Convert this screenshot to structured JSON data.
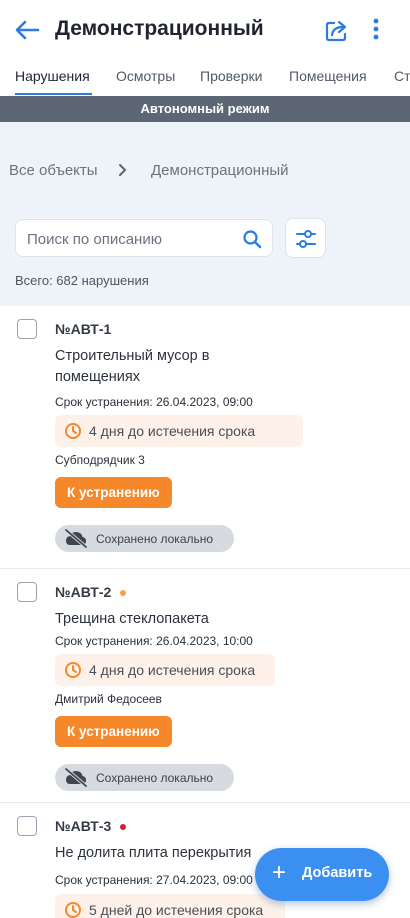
{
  "header": {
    "title": "Демонстрационный",
    "back_icon": "arrow-left-icon",
    "share_icon": "share-icon",
    "more_icon": "more-vertical-icon"
  },
  "tabs": [
    {
      "label": "Нарушения",
      "active": true
    },
    {
      "label": "Осмотры",
      "active": false
    },
    {
      "label": "Проверки",
      "active": false
    },
    {
      "label": "Помещения",
      "active": false
    },
    {
      "label": "Ст",
      "active": false
    }
  ],
  "offline_banner": "Автономный режим",
  "breadcrumb": {
    "items": [
      "Все объекты",
      "Демонстрационный"
    ]
  },
  "search": {
    "placeholder": "Поиск по описанию",
    "value": ""
  },
  "total_label": "Всего: 682 нарушения",
  "violations": [
    {
      "id": "№АВТ-1",
      "dot_color": "",
      "description": "Строительный мусор в помещениях",
      "deadline": "Срок устранения: 26.04.2023, 09:00",
      "time_left": "4 дня до истечения срока",
      "assignee": "Субподрядчик 3",
      "status": "К устранению",
      "sync": "Сохранено локально"
    },
    {
      "id": "№АВТ-2",
      "dot_color": "#f5a14a",
      "description": "Трещина стеклопакета",
      "deadline": "Срок устранения: 26.04.2023, 10:00",
      "time_left": "4 дня до истечения срока",
      "assignee": "Дмитрий Федосеев",
      "status": "К устранению",
      "sync": "Сохранено локально"
    },
    {
      "id": "№АВТ-3",
      "dot_color": "#d3222a",
      "description": "Не долита плита перекрытия",
      "deadline": "Срок устранения: 27.04.2023, 09:00",
      "time_left": "5 дней до истечения срока"
    }
  ],
  "fab": {
    "icon": "plus-icon",
    "label": "Добавить"
  },
  "colors": {
    "accent": "#2b7be4",
    "status_orange": "#f5882b",
    "offline_bar": "#5c6675",
    "panel_bg": "#eef3f9"
  }
}
